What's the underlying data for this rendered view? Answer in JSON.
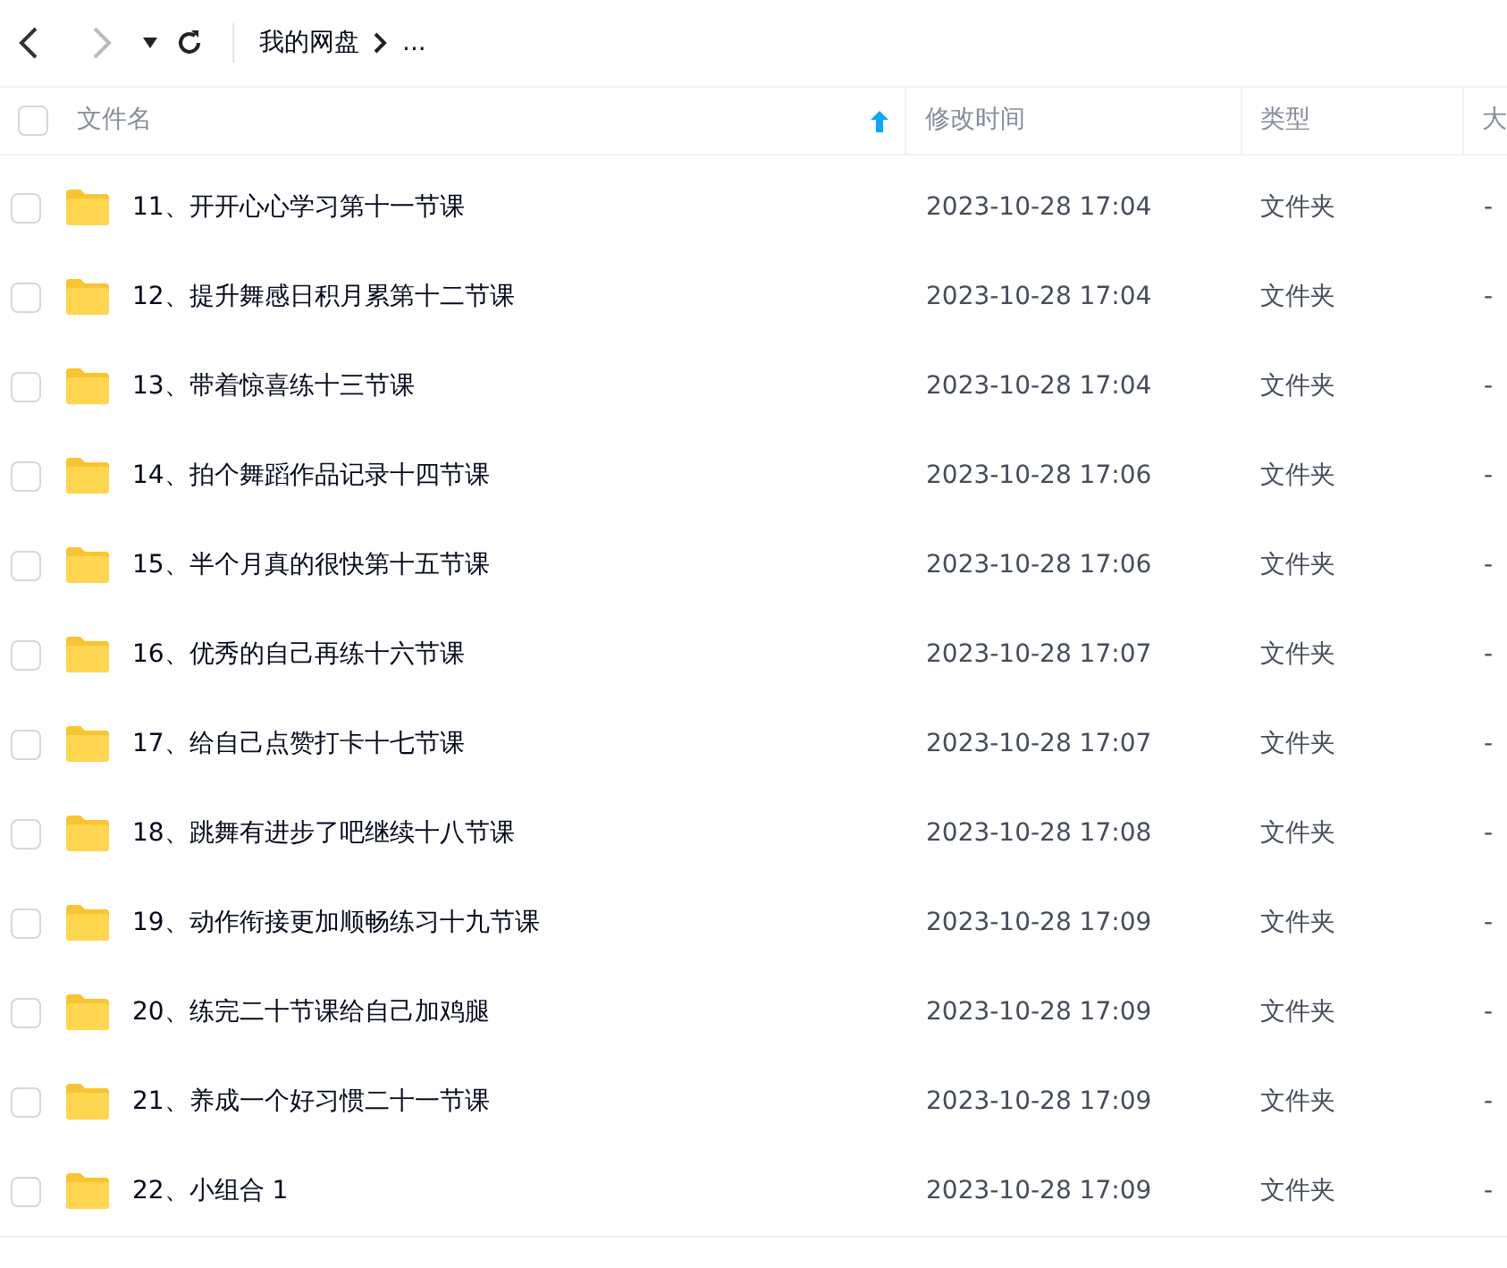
{
  "toolbar": {
    "breadcrumb": [
      {
        "label": "我的网盘"
      },
      {
        "label": "..."
      }
    ]
  },
  "table": {
    "columns": [
      {
        "label": "文件名",
        "sorted": true
      },
      {
        "label": "修改时间",
        "sorted": false
      },
      {
        "label": "类型",
        "sorted": false
      },
      {
        "label": "大",
        "sorted": false
      }
    ],
    "all_checked": false,
    "rows": [
      {
        "name": "11、开开心心学习第十一节课",
        "modified": "2023-10-28 17:04",
        "type": "文件夹",
        "size": "-",
        "checked": false
      },
      {
        "name": "12、提升舞感日积月累第十二节课",
        "modified": "2023-10-28 17:04",
        "type": "文件夹",
        "size": "-",
        "checked": false
      },
      {
        "name": "13、带着惊喜练十三节课",
        "modified": "2023-10-28 17:04",
        "type": "文件夹",
        "size": "-",
        "checked": false
      },
      {
        "name": "14、拍个舞蹈作品记录十四节课",
        "modified": "2023-10-28 17:06",
        "type": "文件夹",
        "size": "-",
        "checked": false
      },
      {
        "name": "15、半个月真的很快第十五节课",
        "modified": "2023-10-28 17:06",
        "type": "文件夹",
        "size": "-",
        "checked": false
      },
      {
        "name": "16、优秀的自己再练十六节课",
        "modified": "2023-10-28 17:07",
        "type": "文件夹",
        "size": "-",
        "checked": false
      },
      {
        "name": "17、给自己点赞打卡十七节课",
        "modified": "2023-10-28 17:07",
        "type": "文件夹",
        "size": "-",
        "checked": false
      },
      {
        "name": "18、跳舞有进步了吧继续十八节课",
        "modified": "2023-10-28 17:08",
        "type": "文件夹",
        "size": "-",
        "checked": false
      },
      {
        "name": "19、动作衔接更加顺畅练习十九节课",
        "modified": "2023-10-28 17:09",
        "type": "文件夹",
        "size": "-",
        "checked": false
      },
      {
        "name": "20、练完二十节课给自己加鸡腿",
        "modified": "2023-10-28 17:09",
        "type": "文件夹",
        "size": "-",
        "checked": false
      },
      {
        "name": "21、养成一个好习惯二十一节课",
        "modified": "2023-10-28 17:09",
        "type": "文件夹",
        "size": "-",
        "checked": false
      },
      {
        "name": "22、小组合 1",
        "modified": "2023-10-28 17:09",
        "type": "文件夹",
        "size": "-",
        "checked": false
      }
    ]
  }
}
